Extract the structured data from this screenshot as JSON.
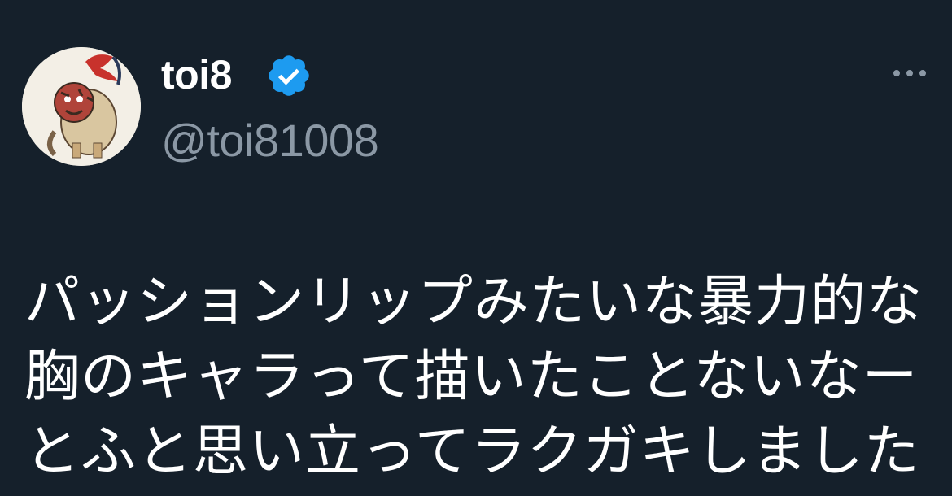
{
  "tweet": {
    "author": {
      "display_name": "toi8",
      "handle": "@toi81008",
      "verified": true,
      "verified_badge_icon": "verified-badge-icon",
      "avatar_icon": "avatar-illustration"
    },
    "more_icon": "more-options-icon",
    "text_lines": [
      "パッションリップみたいな暴力的な",
      "胸のキャラって描いたことないなー",
      "とふと思い立ってラクガキしました"
    ]
  },
  "colors": {
    "background": "#15202b",
    "text_primary": "#ffffff",
    "text_secondary": "#8b98a5",
    "verified_blue": "#1d9bf0"
  }
}
